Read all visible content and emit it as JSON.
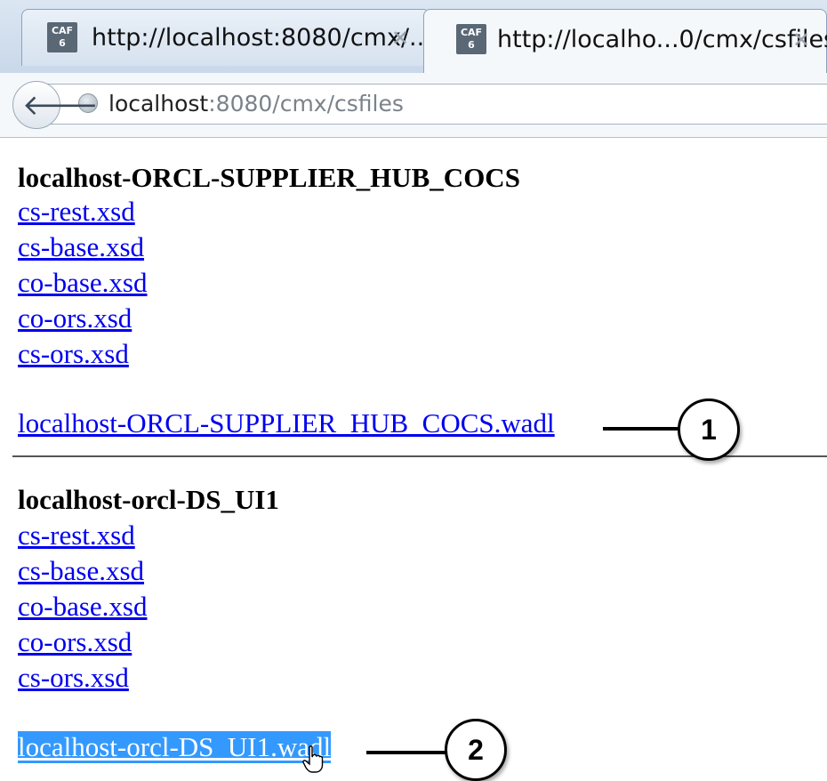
{
  "browser": {
    "tabs": [
      {
        "title": "http://localhost:8080/cmx/...",
        "favicon": "CAF\n6",
        "close": "✕"
      },
      {
        "title": "http://localho...0/cmx/csfiles",
        "favicon": "CAF\n6",
        "close": "✕"
      }
    ],
    "back": "🡐",
    "url_host": "localhost",
    "url_rest": ":8080/cmx/csfiles"
  },
  "groups": [
    {
      "title": "localhost-ORCL-SUPPLIER_HUB_COCS",
      "files": [
        "cs-rest.xsd",
        "cs-base.xsd",
        "co-base.xsd",
        "co-ors.xsd",
        "cs-ors.xsd"
      ],
      "wadl": "localhost-ORCL-SUPPLIER_HUB_COCS.wadl",
      "callout": "1"
    },
    {
      "title": "localhost-orcl-DS_UI1",
      "files": [
        "cs-rest.xsd",
        "cs-base.xsd",
        "co-base.xsd",
        "co-ors.xsd",
        "cs-ors.xsd"
      ],
      "wadl": "localhost-orcl-DS_UI1.wadl",
      "callout": "2"
    }
  ],
  "colors": {
    "link": "#0000ee",
    "selection": "#3399ff",
    "tabstrip": "#c9d8ea"
  }
}
